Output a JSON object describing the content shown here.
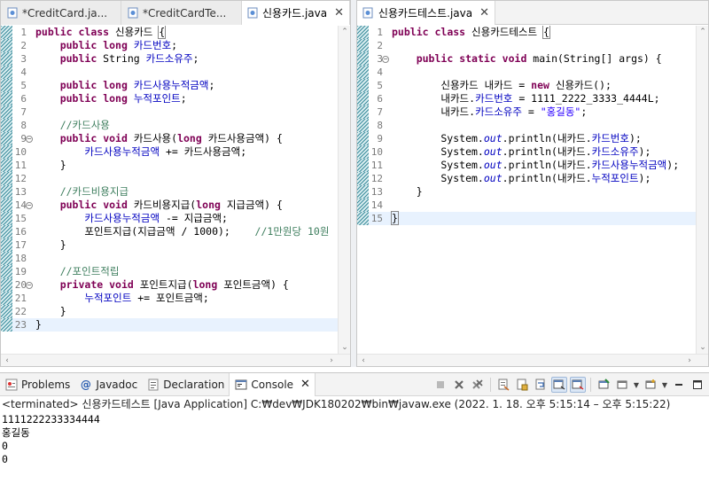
{
  "left_editor": {
    "tabs": [
      {
        "label": "*CreditCard.ja...",
        "active": false
      },
      {
        "label": "*CreditCardTe...",
        "active": false
      },
      {
        "label": "신용카드.java",
        "active": true
      }
    ],
    "lines": [
      {
        "n": "1",
        "text": "public class 신용카드 {"
      },
      {
        "n": "2",
        "text": "    public long 카드번호;"
      },
      {
        "n": "3",
        "text": "    public String 카드소유주;"
      },
      {
        "n": "4",
        "text": ""
      },
      {
        "n": "5",
        "text": "    public long 카드사용누적금액;"
      },
      {
        "n": "6",
        "text": "    public long 누적포인트;"
      },
      {
        "n": "7",
        "text": ""
      },
      {
        "n": "8",
        "text": "    //카드사용"
      },
      {
        "n": "9",
        "text": "    public void 카드사용(long 카드사용금액) {"
      },
      {
        "n": "10",
        "text": "        카드사용누적금액 += 카드사용금액;"
      },
      {
        "n": "11",
        "text": "    }"
      },
      {
        "n": "12",
        "text": ""
      },
      {
        "n": "13",
        "text": "    //카드비용지급"
      },
      {
        "n": "14",
        "text": "    public void 카드비용지급(long 지급금액) {"
      },
      {
        "n": "15",
        "text": "        카드사용누적금액 -= 지급금액;"
      },
      {
        "n": "16",
        "text": "        포인트지급(지급금액 / 1000);    //1만원당 10원"
      },
      {
        "n": "17",
        "text": "    }"
      },
      {
        "n": "18",
        "text": ""
      },
      {
        "n": "19",
        "text": "    //포인트적립"
      },
      {
        "n": "20",
        "text": "    private void 포인트지급(long 포인트금액) {"
      },
      {
        "n": "21",
        "text": "        누적포인트 += 포인트금액;"
      },
      {
        "n": "22",
        "text": "    }"
      },
      {
        "n": "23",
        "text": "}"
      }
    ]
  },
  "right_editor": {
    "tabs": [
      {
        "label": "신용카드테스트.java",
        "active": true
      }
    ],
    "lines": [
      {
        "n": "1",
        "text": "public class 신용카드테스트 {"
      },
      {
        "n": "2",
        "text": ""
      },
      {
        "n": "3",
        "text": "    public static void main(String[] args) {"
      },
      {
        "n": "4",
        "text": ""
      },
      {
        "n": "5",
        "text": "        신용카드 내카드 = new 신용카드();"
      },
      {
        "n": "6",
        "text": "        내카드.카드번호 = 1111_2222_3333_4444L;"
      },
      {
        "n": "7",
        "text": "        내카드.카드소유주 = \"홍길동\";"
      },
      {
        "n": "8",
        "text": ""
      },
      {
        "n": "9",
        "text": "        System.out.println(내카드.카드번호);"
      },
      {
        "n": "10",
        "text": "        System.out.println(내카드.카드소유주);"
      },
      {
        "n": "11",
        "text": "        System.out.println(내카드.카드사용누적금액);"
      },
      {
        "n": "12",
        "text": "        System.out.println(내카드.누적포인트);"
      },
      {
        "n": "13",
        "text": "    }"
      },
      {
        "n": "14",
        "text": ""
      },
      {
        "n": "15",
        "text": "}"
      }
    ]
  },
  "console": {
    "tabs": [
      {
        "label": "Problems",
        "icon": "problems-icon"
      },
      {
        "label": "Javadoc",
        "icon": "javadoc-icon"
      },
      {
        "label": "Declaration",
        "icon": "declaration-icon"
      },
      {
        "label": "Console",
        "icon": "console-icon",
        "active": true
      }
    ],
    "status": "<terminated> 신용카드테스트 [Java Application] C:₩dev₩JDK180202₩bin₩javaw.exe  (2022. 1. 18. 오후 5:15:14 – 오후 5:15:22)",
    "output": [
      "1111222233334444",
      "홍길동",
      "0",
      "0"
    ]
  },
  "colors": {
    "keyword": "#7f0055",
    "comment": "#3f7f5f",
    "field": "#0000c0",
    "string": "#2a00ff",
    "current_line": "#e8f2fe"
  }
}
